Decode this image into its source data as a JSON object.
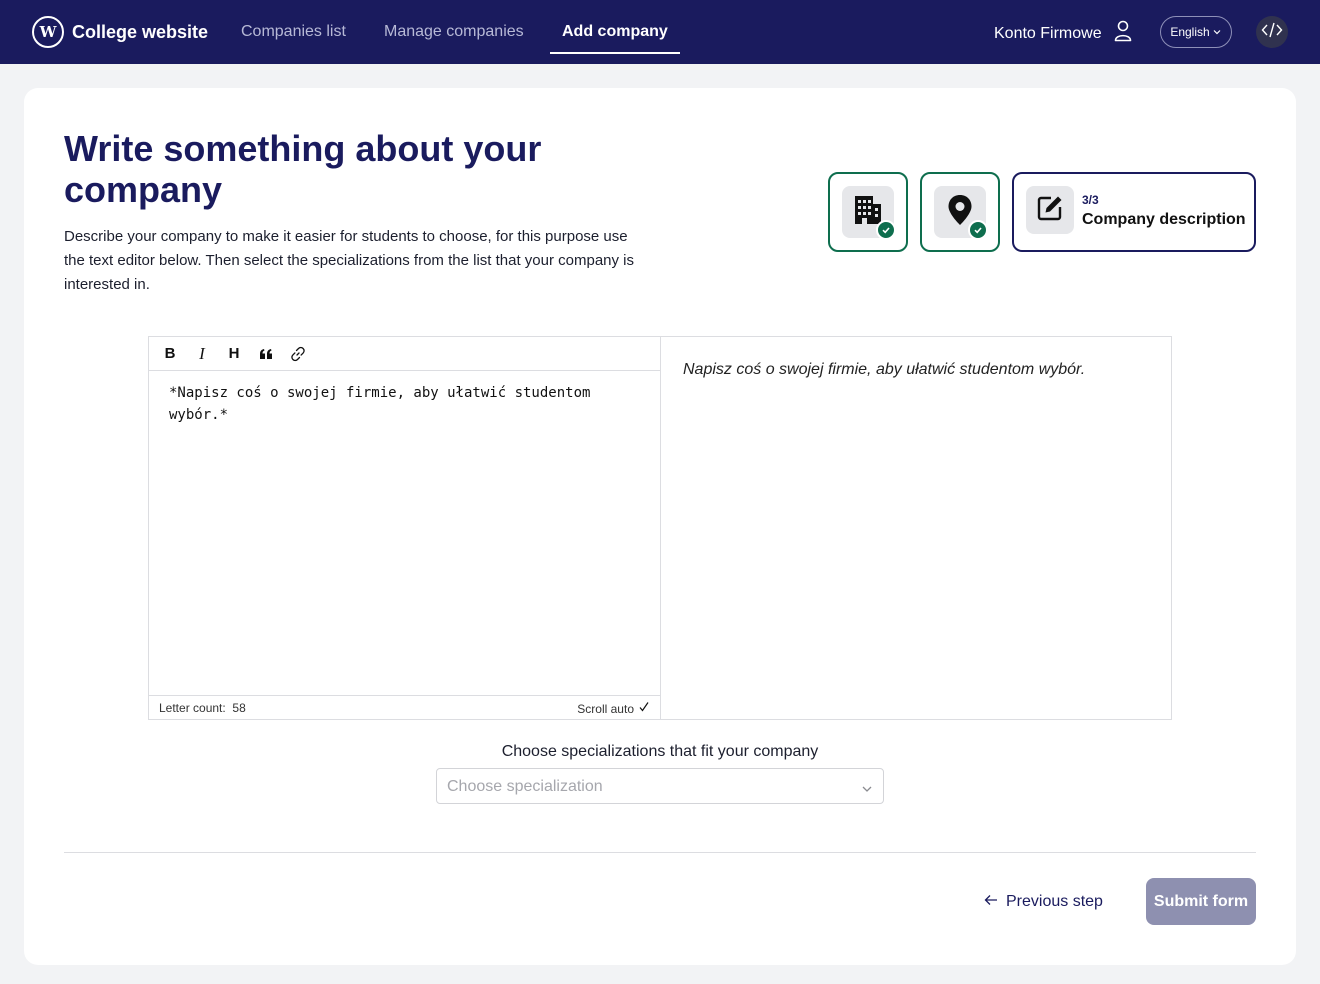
{
  "navbar": {
    "brand_logo_letter": "W",
    "brand_name": "College website",
    "links": [
      "Companies list",
      "Manage companies",
      "Add company"
    ],
    "active_link": "Add company",
    "account_name": "Konto Firmowe",
    "language": "English"
  },
  "page": {
    "title": "Write something about your company",
    "description": "Describe your company to make it easier for students to choose, for this purpose use the text editor below. Then select the specializations from the list that your company is interested in."
  },
  "steps": [
    {
      "icon": "building-icon",
      "status": "done"
    },
    {
      "icon": "location-pin-icon",
      "status": "done"
    },
    {
      "icon": "edit-icon",
      "status": "current",
      "count": "3/3",
      "label": "Company description"
    }
  ],
  "editor": {
    "toolbar": [
      "bold",
      "italic",
      "heading",
      "quote",
      "link"
    ],
    "toolbar_glyphs": {
      "bold": "B",
      "italic": "I",
      "heading": "H"
    },
    "content": "*Napisz coś o swojej firmie, aby ułatwić studentom wybór.*",
    "letter_count_label": "Letter count:",
    "letter_count": "58",
    "scroll_auto_label": "Scroll auto",
    "scroll_auto_checked": true,
    "preview": "Napisz coś o swojej firmie, aby ułatwić studentom wybór."
  },
  "specialization": {
    "label": "Choose specializations that fit your company",
    "placeholder": "Choose specialization"
  },
  "actions": {
    "previous_label": "Previous step",
    "submit_label": "Submit form"
  },
  "colors": {
    "navbar": "#1a1b5e",
    "done_step": "#0e6e4e",
    "submit_disabled": "#8e90b0"
  }
}
